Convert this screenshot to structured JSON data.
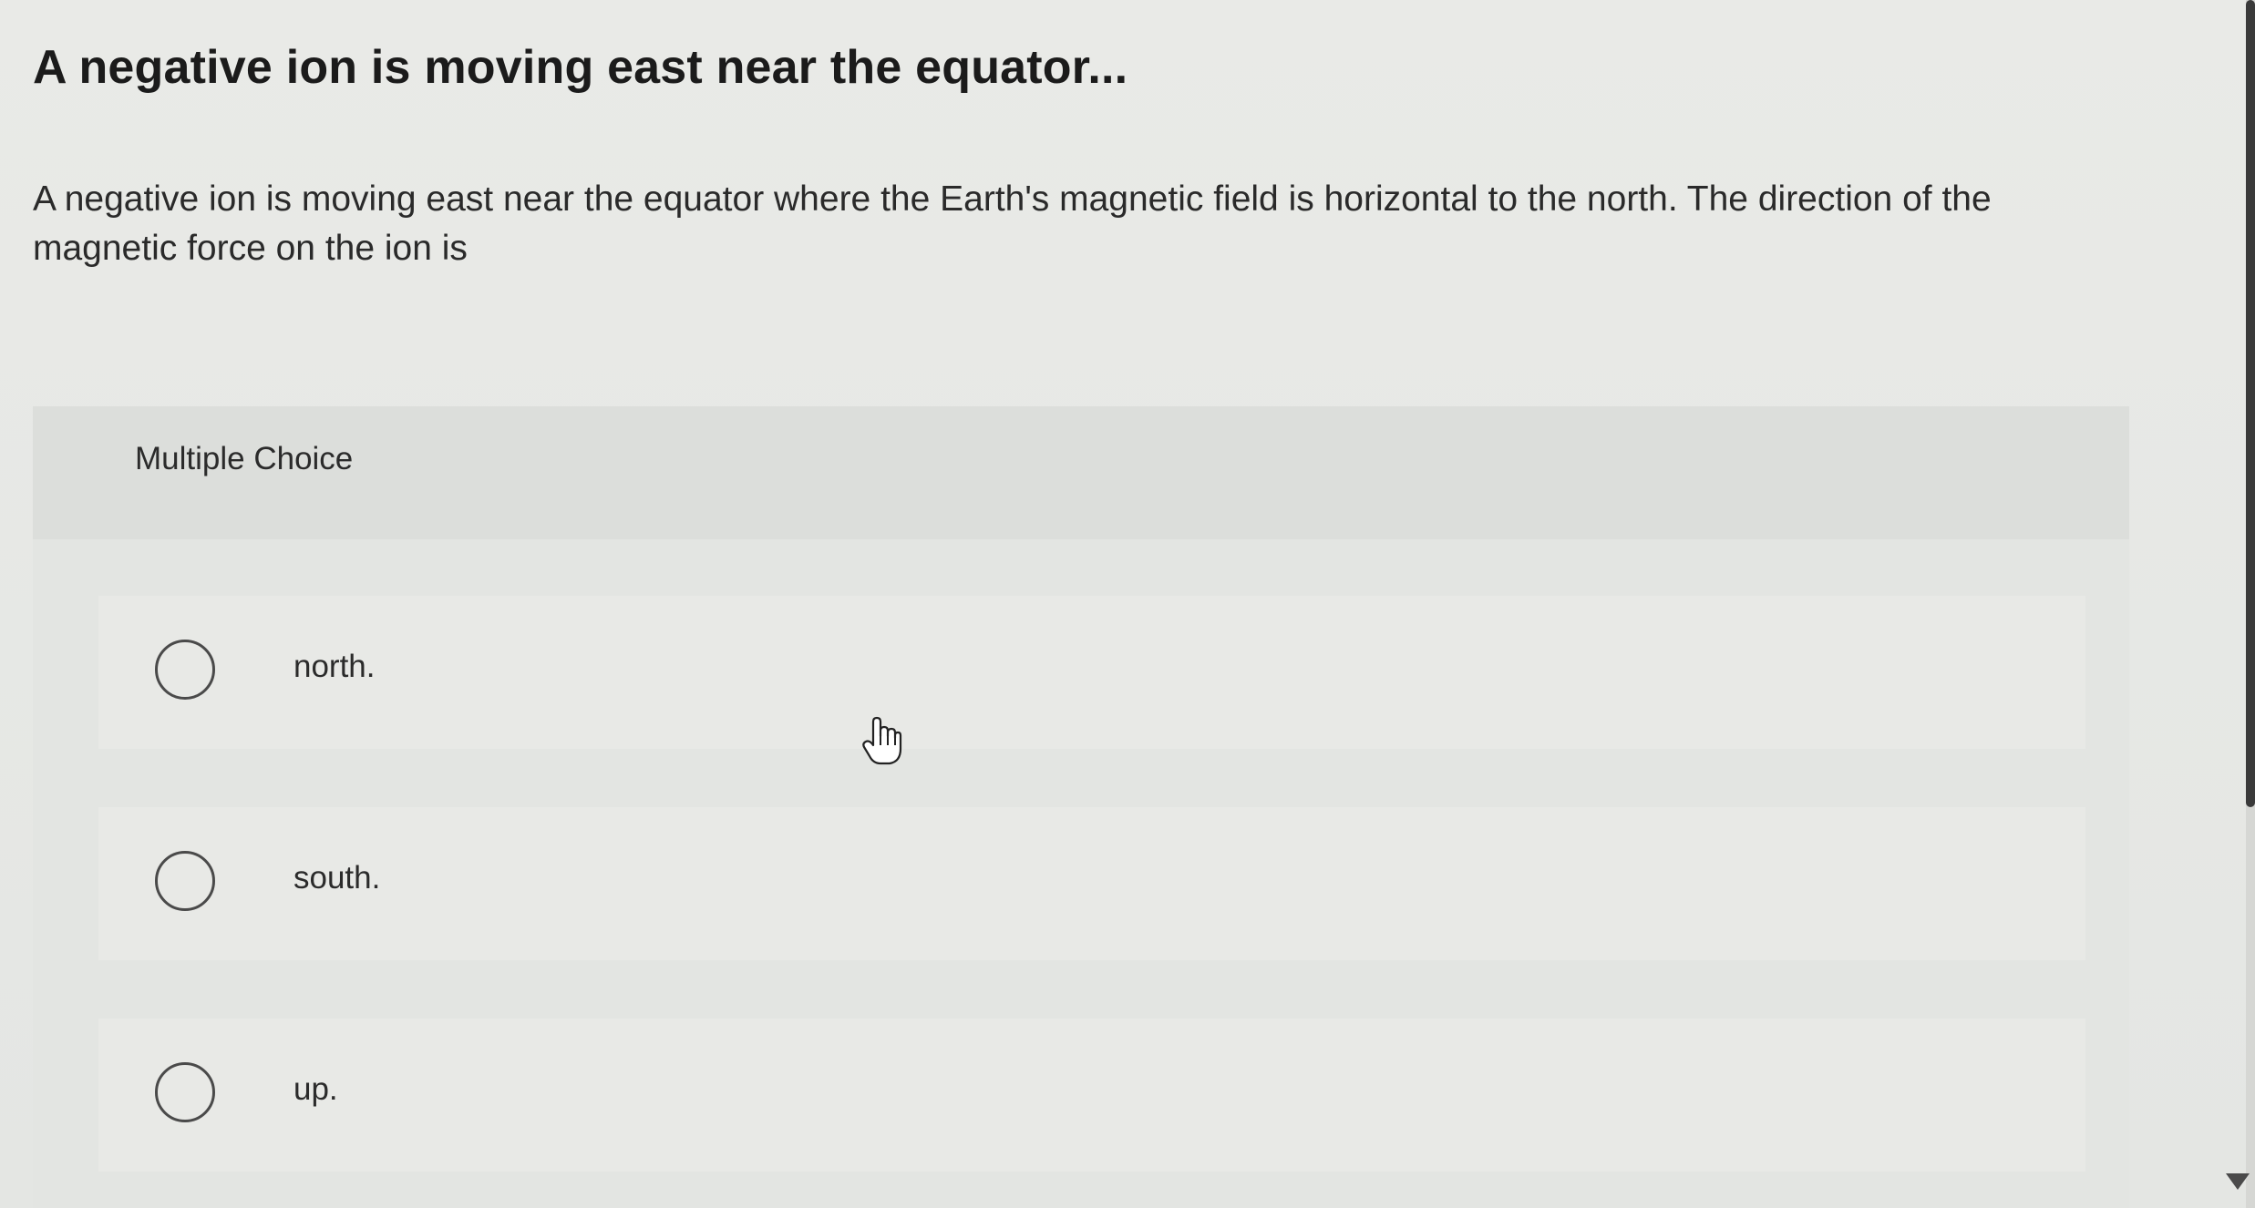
{
  "question": {
    "title": "A negative ion is moving east near the equator...",
    "prompt": "A negative ion is moving east near the equator where the Earth's magnetic field is horizontal to the north. The direction of the magnetic force on the ion is"
  },
  "choices": {
    "type_label": "Multiple Choice",
    "options": [
      {
        "label": "north."
      },
      {
        "label": "south."
      },
      {
        "label": "up."
      }
    ]
  },
  "icons": {
    "cursor": "hand-pointer-icon",
    "radio": "radio-button-icon",
    "scroll": "chevron-down-icon"
  },
  "colors": {
    "background": "#e6e7e4",
    "panel_header": "#dcdedb",
    "radio_border": "#4a4a4a"
  }
}
